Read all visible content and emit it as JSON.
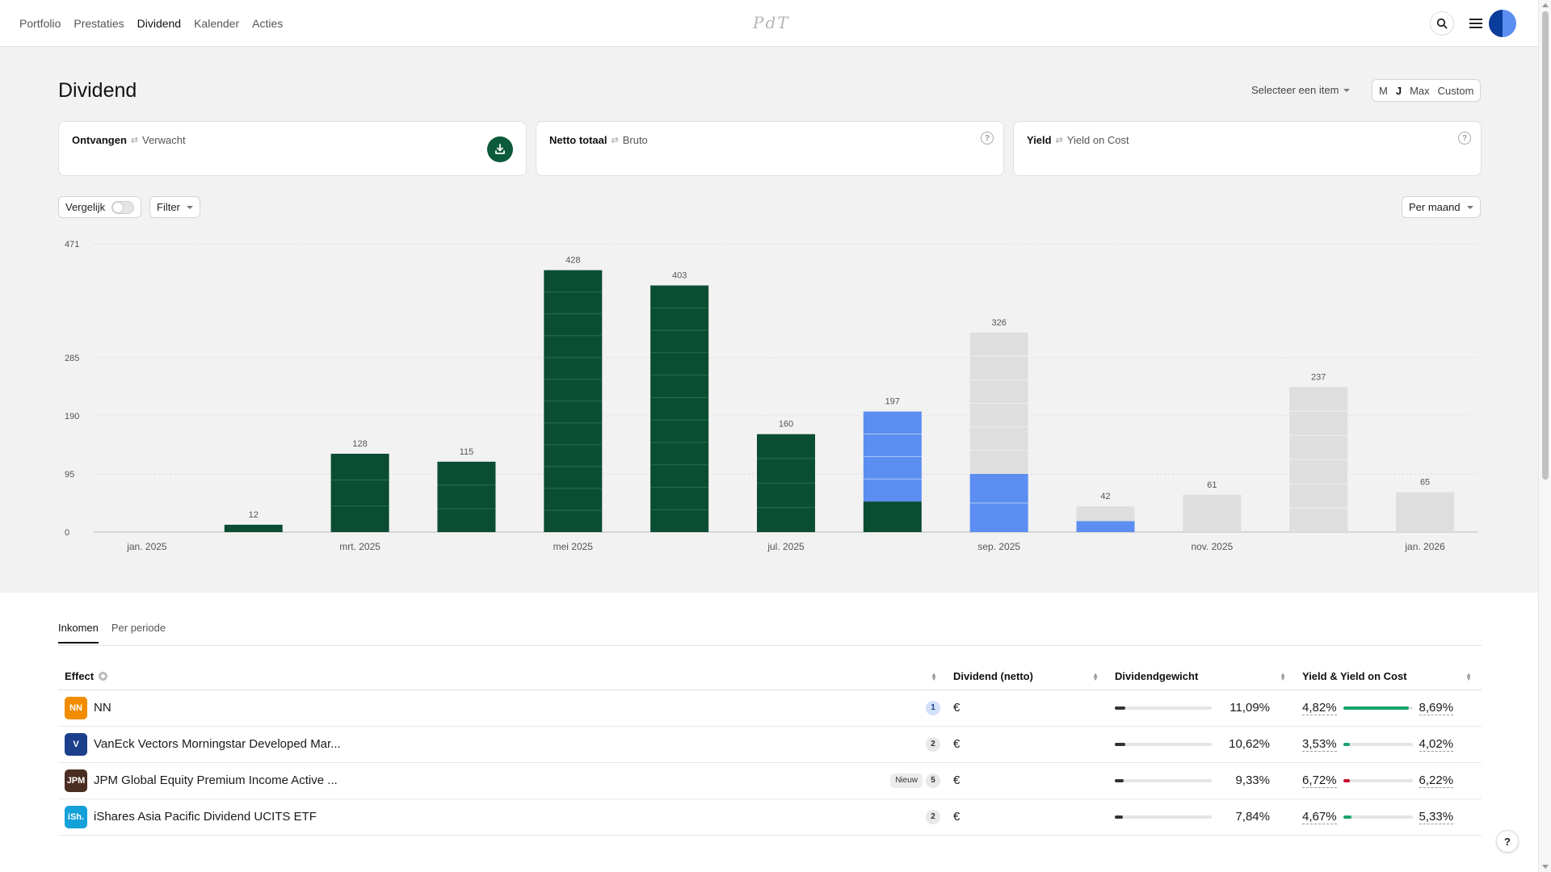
{
  "nav": {
    "items": [
      "Portfolio",
      "Prestaties",
      "Dividend",
      "Kalender",
      "Acties"
    ],
    "active": "Dividend",
    "logo": "PdT"
  },
  "page": {
    "title": "Dividend",
    "select_item": "Selecteer een item",
    "ranges": [
      "M",
      "J",
      "Max",
      "Custom"
    ],
    "active_range": "J"
  },
  "cards": [
    {
      "primary": "Ontvangen",
      "secondary": "Verwacht",
      "icon": "download-icon"
    },
    {
      "primary": "Netto totaal",
      "secondary": "Bruto",
      "icon": "help-icon"
    },
    {
      "primary": "Yield",
      "secondary": "Yield on Cost",
      "icon": "help-icon"
    }
  ],
  "controls": {
    "compare_label": "Vergelijk",
    "filter_label": "Filter",
    "period_label": "Per maand"
  },
  "colors": {
    "received": "#0b4d32",
    "expected_blue": "#5b8ef0",
    "expected_grey": "#dedede",
    "accent_green": "#17a36b",
    "negative_red": "#c8102e"
  },
  "chart_data": {
    "type": "bar",
    "stacked": true,
    "categories": [
      "jan. 2025",
      "feb. 2025",
      "mrt. 2025",
      "apr. 2025",
      "mei 2025",
      "jun. 2025",
      "jul. 2025",
      "aug. 2025",
      "sep. 2025",
      "okt. 2025",
      "nov. 2025",
      "dec. 2025",
      "jan. 2026"
    ],
    "tick_labels": [
      "jan. 2025",
      "mrt. 2025",
      "mei 2025",
      "jul. 2025",
      "sep. 2025",
      "nov. 2025",
      "jan. 2026"
    ],
    "totals": [
      0,
      12,
      128,
      115,
      428,
      403,
      160,
      197,
      326,
      42,
      61,
      237,
      65
    ],
    "series": [
      {
        "values": [
          0,
          12,
          128,
          115,
          428,
          403,
          160,
          50,
          0,
          0,
          0,
          0,
          0
        ]
      },
      {
        "values": [
          0,
          0,
          0,
          0,
          0,
          0,
          0,
          147,
          95,
          18,
          0,
          0,
          0
        ]
      },
      {
        "values": [
          0,
          0,
          0,
          0,
          0,
          0,
          0,
          0,
          231,
          24,
          61,
          237,
          65
        ]
      }
    ],
    "y_ticks": [
      0,
      95,
      190,
      285,
      471
    ],
    "ylim": [
      0,
      471
    ],
    "grid": true,
    "legend": "none"
  },
  "tabs": [
    "Inkomen",
    "Per periode"
  ],
  "active_tab": "Inkomen",
  "table": {
    "headers": [
      "Effect",
      "Dividend (netto)",
      "Dividendgewicht",
      "Yield & Yield on Cost"
    ],
    "rows": [
      {
        "name": "NN",
        "logo": "NN",
        "logo_color": "#f28c00",
        "badge": "",
        "count": "1",
        "count_blue": true,
        "currency": "€",
        "weight": "11,09%",
        "weight_frac": 0.11,
        "yield": "4,82%",
        "yoc": "8,69%",
        "ybar_frac": 0.95,
        "ybar_color": "#17a36b"
      },
      {
        "name": "VanEck Vectors Morningstar Developed Mar...",
        "logo": "V",
        "logo_color": "#1b3f8b",
        "badge": "",
        "count": "2",
        "count_blue": false,
        "currency": "€",
        "weight": "10,62%",
        "weight_frac": 0.11,
        "yield": "3,53%",
        "yoc": "4,02%",
        "ybar_frac": 0.1,
        "ybar_color": "#17a36b"
      },
      {
        "name": "JPM Global Equity Premium Income Active ...",
        "logo": "JPM",
        "logo_color": "#4a2e22",
        "badge": "Nieuw",
        "count": "5",
        "count_blue": false,
        "currency": "€",
        "weight": "9,33%",
        "weight_frac": 0.09,
        "yield": "6,72%",
        "yoc": "6,22%",
        "ybar_frac": 0.1,
        "ybar_color": "#c8102e"
      },
      {
        "name": "iShares Asia Pacific Dividend UCITS ETF",
        "logo": "iSh.",
        "logo_color": "#14a0d8",
        "badge": "",
        "count": "2",
        "count_blue": false,
        "currency": "€",
        "weight": "7,84%",
        "weight_frac": 0.08,
        "yield": "4,67%",
        "yoc": "5,33%",
        "ybar_frac": 0.12,
        "ybar_color": "#17a36b"
      }
    ]
  },
  "help_fab": "?"
}
